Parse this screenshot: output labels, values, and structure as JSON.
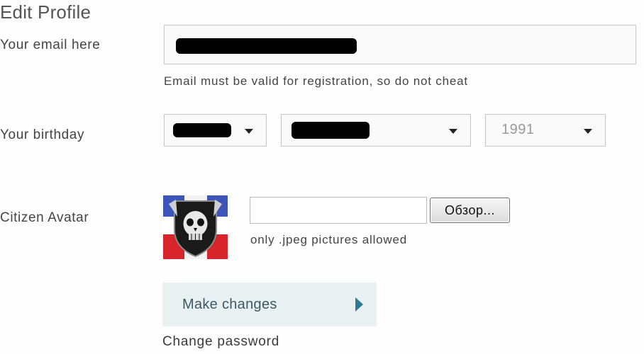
{
  "page": {
    "title": "Edit Profile"
  },
  "email": {
    "label": "Your email here",
    "value": "",
    "value_redacted": true,
    "hint": "Email must be valid for registration, so do not cheat"
  },
  "birthday": {
    "label": "Your birthday",
    "day": {
      "value": "",
      "value_redacted": true
    },
    "month": {
      "value": "",
      "value_redacted": true
    },
    "year": {
      "value": "1991"
    }
  },
  "avatar": {
    "label": "Citizen Avatar",
    "file_value": "",
    "browse_label": "Обзор...",
    "hint": "only .jpeg pictures allowed"
  },
  "actions": {
    "submit_label": "Make changes",
    "change_password_label": "Change password"
  },
  "colors": {
    "submit_bg": "#e9f0f1",
    "submit_text": "#3b5a63",
    "submit_arrow": "#2f7c8f"
  }
}
